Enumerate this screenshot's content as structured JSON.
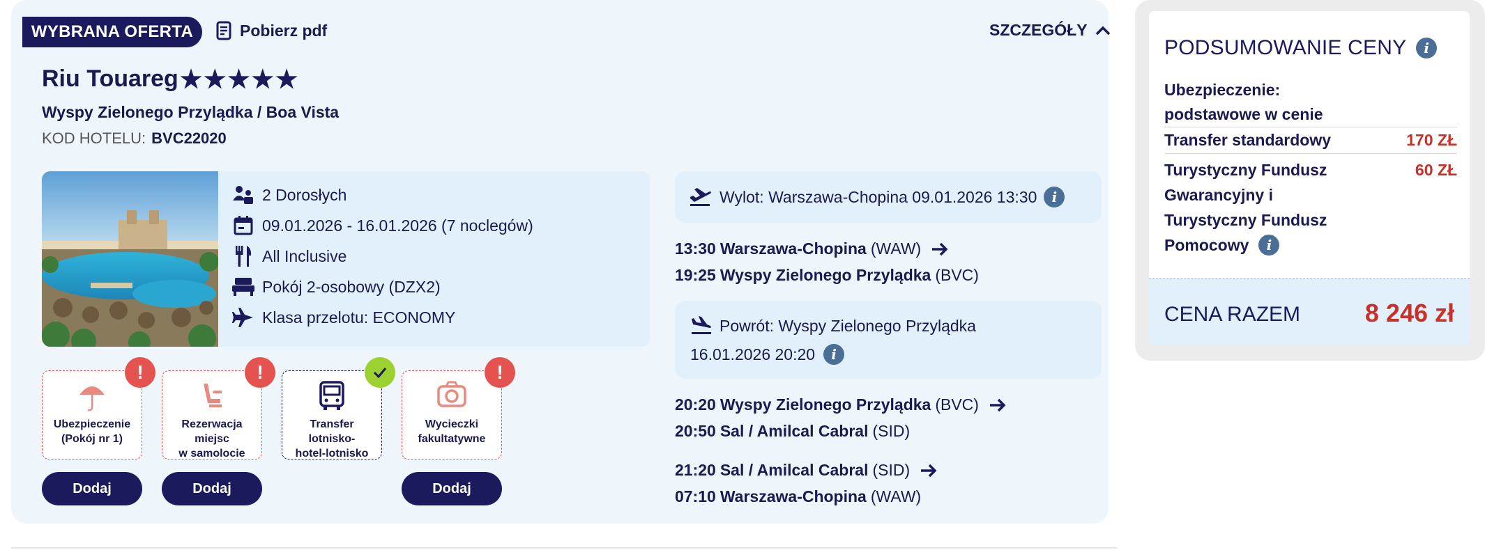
{
  "offer": {
    "badge": "WYBRANA OFERTA",
    "pdf_label": "Pobierz pdf",
    "details_label": "SZCZEGÓŁY",
    "hotel_name": "Riu Touareg",
    "stars": 5,
    "location": "Wyspy Zielonego Przylądka / Boa Vista",
    "code_label": "KOD HOTELU:",
    "code_value": "BVC22020"
  },
  "facts": {
    "guests": "2 Dorosłych",
    "dates": "09.01.2026 - 16.01.2026 (7 noclegów)",
    "board": "All Inclusive",
    "room": "Pokój 2-osobowy (DZX2)",
    "flight_class": "Klasa przelotu: ECONOMY"
  },
  "addons": [
    {
      "line1": "Ubezpieczenie",
      "line2": "(Pokój nr 1)",
      "button": "Dodaj",
      "status": "alert",
      "icon": "umbrella-icon"
    },
    {
      "line1": "Rezerwacja miejsc",
      "line2": "w samolocie",
      "button": "Dodaj",
      "status": "alert",
      "icon": "seat-icon"
    },
    {
      "line1": "Transfer lotnisko-",
      "line2": "hotel-lotnisko",
      "button": "",
      "status": "ok",
      "icon": "bus-icon"
    },
    {
      "line1": "Wycieczki",
      "line2": "fakultatywne",
      "button": "Dodaj",
      "status": "alert",
      "icon": "camera-icon"
    }
  ],
  "flights": {
    "outbound_title": "Wylot: Warszawa-Chopina 09.01.2026 13:30",
    "outbound_legs": [
      {
        "time": "13:30",
        "place": "Warszawa-Chopina",
        "code": "(WAW)"
      },
      {
        "time": "19:25",
        "place": "Wyspy Zielonego Przylądka",
        "code": "(BVC)"
      }
    ],
    "return_title_1": "Powrót: Wyspy Zielonego Przylądka",
    "return_title_2": "16.01.2026 20:20",
    "return_legs": [
      {
        "time": "20:20",
        "place": "Wyspy Zielonego Przylądka",
        "code": "(BVC)"
      },
      {
        "time": "20:50",
        "place": "Sal / Amilcal Cabral",
        "code": "(SID)"
      },
      {
        "time": "21:20",
        "place": "Sal / Amilcal Cabral",
        "code": "(SID)"
      },
      {
        "time": "07:10",
        "place": "Warszawa-Chopina",
        "code": "(WAW)"
      }
    ]
  },
  "summary": {
    "title": "PODSUMOWANIE CENY",
    "insurance_1": "Ubezpieczenie:",
    "insurance_2": "podstawowe w cenie",
    "transfer_label": "Transfer standardowy",
    "transfer_price": "170 ZŁ",
    "fund_1": "Turystyczny Fundusz",
    "fund_2": "Gwarancyjny i",
    "fund_3": "Turystyczny Fundusz",
    "fund_4": "Pomocowy",
    "fund_price": "60 ZŁ",
    "total_label": "CENA RAZEM",
    "total_value": "8 246 zł"
  },
  "colors": {
    "navy": "#1b1a5c",
    "alert": "#e4534f",
    "ok": "#9bd230",
    "price": "#c8302a",
    "panel": "#eef6fc"
  }
}
